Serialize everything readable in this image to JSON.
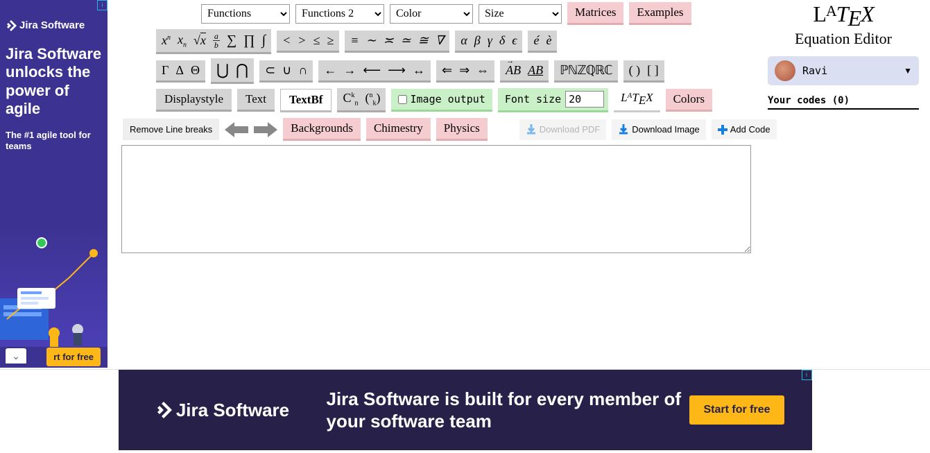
{
  "left_ad": {
    "badge": "i",
    "product": "Jira Software",
    "headline": "Jira Software unlocks the power of agile",
    "subhead": "The #1 agile tool for teams",
    "cta": "rt for free"
  },
  "selects": {
    "functions": "Functions",
    "functions2": "Functions 2",
    "color": "Color",
    "size": "Size"
  },
  "top_buttons": {
    "matrices": "Matrices",
    "examples": "Examples"
  },
  "tool_rowA": {
    "g1": [
      "xⁿ",
      "xₙ",
      "√x",
      "a/b",
      "∑",
      "∏",
      "∫"
    ],
    "g2": [
      "<",
      ">",
      "≤",
      "≥"
    ],
    "g3": [
      "≡",
      "∼",
      "≍",
      "≃",
      "≅",
      "∇"
    ],
    "g4": [
      "α",
      "β",
      "γ",
      "δ",
      "ϵ"
    ],
    "g5": [
      "é",
      "è"
    ]
  },
  "tool_rowB": {
    "g1": [
      "Γ",
      "Δ",
      "Θ"
    ],
    "g2": [
      "⋃",
      "⋂"
    ],
    "g3": [
      "⊂",
      "∪",
      "∩"
    ],
    "g4": [
      "←",
      "→",
      "⟵",
      "⟶",
      "↔"
    ],
    "g5": [
      "⇐",
      "⇒",
      "⇔"
    ],
    "g6": [
      "AB→",
      "AB_"
    ],
    "g7": "ℙℕℤℚℝℂ",
    "g8": [
      "( )",
      "[ ]"
    ]
  },
  "tool_rowC": {
    "displaystyle": "Displaystyle",
    "text": "Text",
    "textbf": "TextBf",
    "cnk": [
      "Cⁿₖ",
      "(ⁿₖ)"
    ],
    "image_output": "Image output",
    "font_size_label": "Font size",
    "font_size_value": "20",
    "latex": "LᴬTᴇX",
    "colors": "Colors"
  },
  "actions": {
    "remove_breaks": "Remove Line breaks",
    "backgrounds": "Backgrounds",
    "chimestry": "Chimestry",
    "physics": "Physics",
    "download_pdf": "Download PDF",
    "download_image": "Download Image",
    "add_code": "Add Code"
  },
  "editor_value": "",
  "right": {
    "logo": "LᴬTᴇX",
    "subtitle": "Equation Editor",
    "user": "Ravi",
    "codes_header": "Your codes (0)"
  },
  "bottom_ad": {
    "badge": "i",
    "product": "Jira Software",
    "text": "Jira Software is built for every member of your software team",
    "cta": "Start for free"
  }
}
